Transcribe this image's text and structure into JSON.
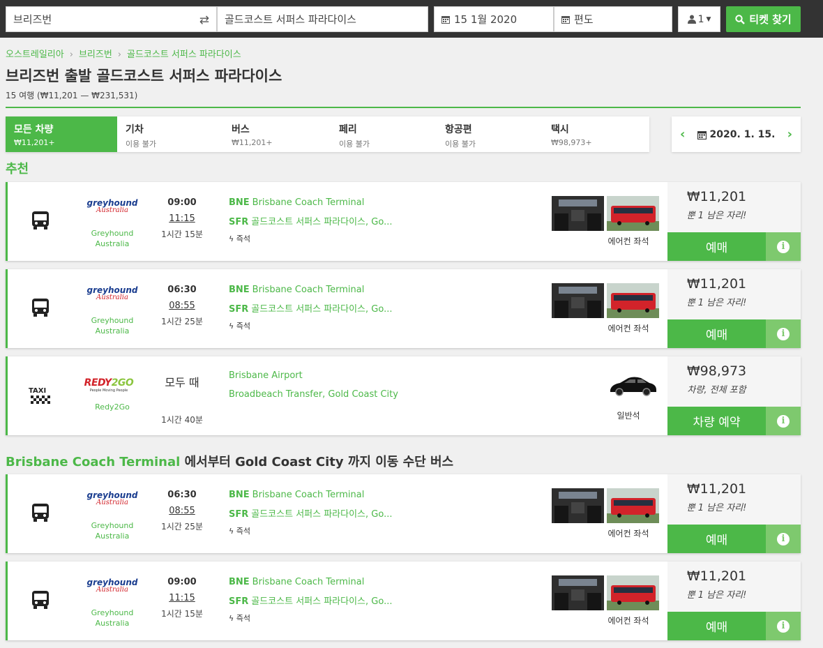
{
  "search": {
    "from": "브리즈번",
    "to": "골드코스트 서퍼스 파라다이스",
    "date": "15 1월 2020",
    "return_placeholder": "편도",
    "passengers": "1",
    "search_button": "티켓 찾기"
  },
  "breadcrumb": [
    "오스트레일리아",
    "브리즈번",
    "골드코스트 서퍼스 파라다이스"
  ],
  "page_title": "브리즈번 출발 골드코스트 서퍼스 파라다이스",
  "subtitle": "15 여행 (₩11,201 — ₩231,531)",
  "tabs": [
    {
      "label": "모든 차량",
      "sub": "₩11,201+"
    },
    {
      "label": "기차",
      "sub": "이용 불가"
    },
    {
      "label": "버스",
      "sub": "₩11,201+"
    },
    {
      "label": "페리",
      "sub": "이용 불가"
    },
    {
      "label": "항공편",
      "sub": "이용 불가"
    },
    {
      "label": "택시",
      "sub": "₩98,973+"
    }
  ],
  "date_nav": {
    "date": "2020. 1. 15.",
    "prev": "‹",
    "next": "›"
  },
  "sections": {
    "recommended": "추천",
    "bus_prefix": "Brisbane Coach Terminal",
    "bus_rest": " 에서부터 Gold Coast City 까지 이동 수단 버스"
  },
  "results": [
    {
      "operator": "Greyhound Australia",
      "logo_main": "greyhound",
      "logo_sub": "Australia",
      "dep": "09:00",
      "arr": "11:15",
      "dur": "1시간 15분",
      "from_code": "BNE",
      "from": "Brisbane Coach Terminal",
      "to_code": "SFR",
      "to": "골드코스트 서퍼스 파라다이스, Go...",
      "feature": "즉석",
      "amenity": "에어컨 좌석",
      "price": "₩11,201",
      "note": "뿐 1 남은 자리!",
      "button": "예매"
    },
    {
      "operator": "Greyhound Australia",
      "logo_main": "greyhound",
      "logo_sub": "Australia",
      "dep": "06:30",
      "arr": "08:55",
      "dur": "1시간 25분",
      "from_code": "BNE",
      "from": "Brisbane Coach Terminal",
      "to_code": "SFR",
      "to": "골드코스트 서퍼스 파라다이스, Go...",
      "feature": "즉석",
      "amenity": "에어컨 좌석",
      "price": "₩11,201",
      "note": "뿐 1 남은 자리!",
      "button": "예매"
    },
    {
      "operator": "Rydy2Go",
      "mode": "TAXI",
      "logo_a": "REDY",
      "logo_b": "2GO",
      "logo_tag": "People Moving People",
      "op_name": "Redy2Go",
      "anytime": "모두 때",
      "dur": "1시간 40분",
      "from": "Brisbane Airport",
      "to": "Broadbeach Transfer, Gold Coast City",
      "amenity": "일반석",
      "price": "₩98,973",
      "note": "차량, 전체 포함",
      "button": "차량 예약"
    },
    {
      "operator": "Greyhound Australia",
      "logo_main": "greyhound",
      "logo_sub": "Australia",
      "dep": "06:30",
      "arr": "08:55",
      "dur": "1시간 25분",
      "from_code": "BNE",
      "from": "Brisbane Coach Terminal",
      "to_code": "SFR",
      "to": "골드코스트 서퍼스 파라다이스, Go...",
      "feature": "즉석",
      "amenity": "에어컨 좌석",
      "price": "₩11,201",
      "note": "뿐 1 남은 자리!",
      "button": "예매"
    },
    {
      "operator": "Greyhound Australia",
      "logo_main": "greyhound",
      "logo_sub": "Australia",
      "dep": "09:00",
      "arr": "11:15",
      "dur": "1시간 15분",
      "from_code": "BNE",
      "from": "Brisbane Coach Terminal",
      "to_code": "SFR",
      "to": "골드코스트 서퍼스 파라다이스, Go...",
      "feature": "즉석",
      "amenity": "에어컨 좌석",
      "price": "₩11,201",
      "note": "뿐 1 남은 자리!",
      "button": "예매"
    }
  ],
  "colors": {
    "accent": "#4cb848",
    "topbar": "#333333",
    "info": "#7ec96e"
  }
}
